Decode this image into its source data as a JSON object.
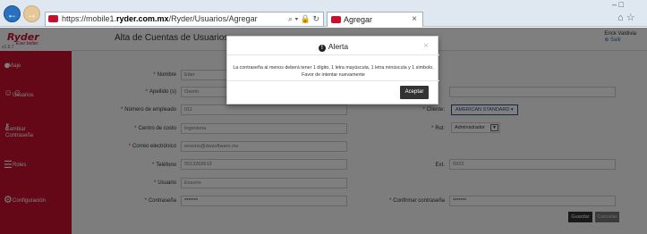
{
  "browser": {
    "url_prefix": "https://mobile1.",
    "url_domain": "ryder.com.mx",
    "url_path": "/Ryder/Usuarios/Agregar",
    "url_tools": "⌕ ▾ 🔒 ↻",
    "tab_title": "Agregar",
    "tab_close": "×",
    "window_controls": "–   □",
    "toolbar_icons": "⌂ ☆"
  },
  "app": {
    "logo": "Ryder",
    "tagline": "Ever better.",
    "version": "v1.0.7",
    "page_title": "Alta de Cuentas de Usuarios",
    "user_name": "Erick Valdivia",
    "logout": "⊕ Salir"
  },
  "sidebar": {
    "items": [
      {
        "label": "Viaje",
        "icon": "map-marker-icon",
        "glyph": "●"
      },
      {
        "label": "Usuarios",
        "icon": "users-icon",
        "glyph": "☺☺"
      },
      {
        "label": "Cambiar Contraseña",
        "icon": "key-icon",
        "glyph": "⚷"
      },
      {
        "label": "Roles",
        "icon": "list-icon",
        "glyph": "☰"
      },
      {
        "label": "Configuración",
        "icon": "gear-icon",
        "glyph": "⚙"
      }
    ]
  },
  "form": {
    "nombre": {
      "label": "Nombre",
      "value": "Eder"
    },
    "apellido": {
      "label": "Apellido (s)",
      "value": "Osorio"
    },
    "numero": {
      "label": "Número de empleado",
      "value": "011"
    },
    "centro": {
      "label": "Centro de costo",
      "value": "Ingenieria"
    },
    "correo": {
      "label": "Correo electrónico",
      "value": "eosorio@dwsoftware.mx"
    },
    "telefono": {
      "label": "Teléfono",
      "value": "5513269613"
    },
    "usuario": {
      "label": "Usuario",
      "value": "Eosorio"
    },
    "contrasena": {
      "label": "Contraseña",
      "value": "*******"
    },
    "cliente": {
      "label": "Cliente:",
      "value": "AMERICAN STANDARD ▾"
    },
    "rol": {
      "label": "Rol:",
      "value": "Administrador",
      "caret": "▼"
    },
    "ext": {
      "label": "Ext.",
      "value": "6923"
    },
    "confirmar": {
      "label": "Confirmar contraseña",
      "value": "*******"
    },
    "guardar": "Guardar",
    "cancelar": "Cancelar",
    "required_mark": "*"
  },
  "modal": {
    "icon": "!",
    "title": "Alerta",
    "close": "×",
    "message_line1": "La contraseña al menos deberá tener 1 dígito, 1 letra mayúscula, 1 letra minúscula y 1 símbolo.",
    "message_line2": "Favor de intentar nuevamente",
    "accept": "Aceptar"
  }
}
